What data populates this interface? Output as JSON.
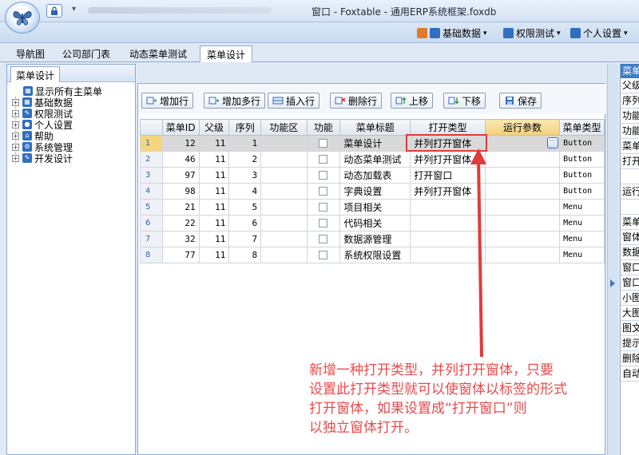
{
  "window": {
    "title": "窗口 - Foxtable - 通用ERP系统框架.foxdb"
  },
  "menubar": {
    "items": [
      {
        "label": "基础数据",
        "icon": "database-icon",
        "color": "#2f6fc0"
      },
      {
        "label": "权限测试",
        "icon": "key-icon",
        "color": "#2f6fc0"
      },
      {
        "label": "个人设置",
        "icon": "user-icon",
        "color": "#2f6fc0"
      }
    ]
  },
  "tabs": [
    {
      "label": "导航图",
      "active": false
    },
    {
      "label": "公司部门表",
      "active": false
    },
    {
      "label": "动态菜单测试",
      "active": false
    },
    {
      "label": "菜单设计",
      "active": true
    }
  ],
  "left_pane": {
    "tab_label": "菜单设计",
    "tree": [
      {
        "label": "显示所有主菜单",
        "icon": "table-icon"
      },
      {
        "label": "基础数据",
        "icon": "table-icon"
      },
      {
        "label": "权限测试",
        "icon": "key-icon"
      },
      {
        "label": "个人设置",
        "icon": "user-icon"
      },
      {
        "label": "帮助",
        "icon": "home-icon"
      },
      {
        "label": "系统管理",
        "icon": "settings-icon"
      },
      {
        "label": "开发设计",
        "icon": "wrench-icon"
      }
    ]
  },
  "toolbar": {
    "add_row": "增加行",
    "add_rows": "增加多行",
    "insert_row": "插入行",
    "delete_row": "删除行",
    "move_up": "上移",
    "move_down": "下移",
    "save": "保存"
  },
  "grid": {
    "columns": [
      "菜单ID",
      "父级",
      "序列",
      "功能区",
      "功能",
      "菜单标题",
      "打开类型",
      "运行参数",
      "菜单类型"
    ],
    "rows": [
      {
        "n": "1",
        "id": "12",
        "parent": "11",
        "seq": "1",
        "title": "菜单设计",
        "open_type": "并列打开窗体",
        "menu_type": "Button"
      },
      {
        "n": "2",
        "id": "46",
        "parent": "11",
        "seq": "2",
        "title": "动态菜单测试",
        "open_type": "并列打开窗体",
        "menu_type": "Button"
      },
      {
        "n": "3",
        "id": "97",
        "parent": "11",
        "seq": "3",
        "title": "动态加载表",
        "open_type": "打开窗口",
        "menu_type": "Button"
      },
      {
        "n": "4",
        "id": "98",
        "parent": "11",
        "seq": "4",
        "title": "字典设置",
        "open_type": "并列打开窗体",
        "menu_type": "Button"
      },
      {
        "n": "5",
        "id": "21",
        "parent": "11",
        "seq": "5",
        "title": "项目相关",
        "open_type": "",
        "menu_type": "Menu"
      },
      {
        "n": "6",
        "id": "22",
        "parent": "11",
        "seq": "6",
        "title": "代码相关",
        "open_type": "",
        "menu_type": "Menu"
      },
      {
        "n": "7",
        "id": "32",
        "parent": "11",
        "seq": "7",
        "title": "数据源管理",
        "open_type": "",
        "menu_type": "Menu"
      },
      {
        "n": "8",
        "id": "77",
        "parent": "11",
        "seq": "8",
        "title": "系统权限设置",
        "open_type": "",
        "menu_type": "Menu"
      }
    ],
    "selected_row": 0,
    "highlight_column": "运行参数"
  },
  "right_pane": {
    "header": "菜单",
    "rows": [
      "父级",
      "序列",
      "功能",
      "功能",
      "菜单",
      "打开",
      "",
      "运行",
      "",
      "菜单",
      "窗体",
      "数据",
      "窗口",
      "窗口",
      "小图",
      "大图",
      "图文",
      "提示",
      "删除",
      "自动"
    ]
  },
  "annotation": {
    "lines": [
      "新增一种打开类型，并列打开窗体，只要",
      "设置此打开类型就可以使窗体以标签的形式",
      "打开窗体，如果设置成“打开窗口”则",
      "以独立窗体打开。"
    ],
    "color": "#ea4a4a"
  }
}
